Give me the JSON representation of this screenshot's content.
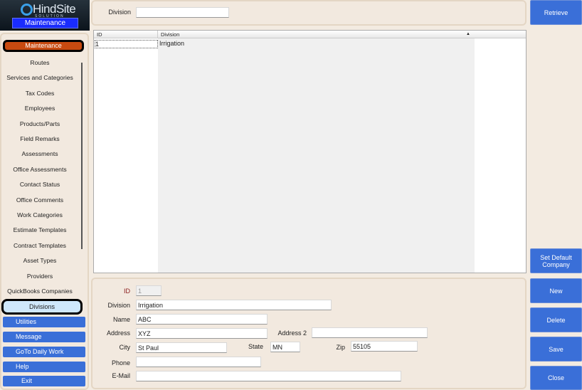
{
  "logo": {
    "brand": "HindSite",
    "sub": "SOLUTION",
    "section": "Maintenance"
  },
  "sidebar": {
    "header": "Maintenance",
    "items": [
      "Routes",
      "Services and Categories",
      "Tax Codes",
      "Employees",
      "Products/Parts",
      "Field Remarks",
      "Assessments",
      "Office Assessments",
      "Contact Status",
      "Office Comments",
      "Work Categories",
      "Estimate Templates",
      "Contract Templates",
      "Asset Types",
      "Providers",
      "QuickBooks Companies"
    ],
    "selected": "Divisions",
    "buttons": [
      "Utilities",
      "Message",
      "GoTo Daily Work",
      "Help",
      "Exit"
    ]
  },
  "search": {
    "label": "Division",
    "value": ""
  },
  "grid": {
    "columns": [
      "ID",
      "Division"
    ],
    "rows": [
      {
        "id": "1",
        "division": "Irrigation"
      }
    ]
  },
  "form": {
    "id_label": "ID",
    "id": "1",
    "division_label": "Division",
    "division": "Irrigation",
    "name_label": "Name",
    "name": "ABC",
    "address_label": "Address",
    "address": "XYZ",
    "address2_label": "Address 2",
    "address2": "",
    "city_label": "City",
    "city": "St Paul",
    "state_label": "State",
    "state": "MN",
    "zip_label": "Zip",
    "zip": "55105",
    "phone_label": "Phone",
    "phone": "",
    "email_label": "E-Mail",
    "email": ""
  },
  "actions": {
    "retrieve": "Retrieve",
    "set_default": "Set Default Company",
    "new": "New",
    "delete": "Delete",
    "save": "Save",
    "close": "Close"
  }
}
